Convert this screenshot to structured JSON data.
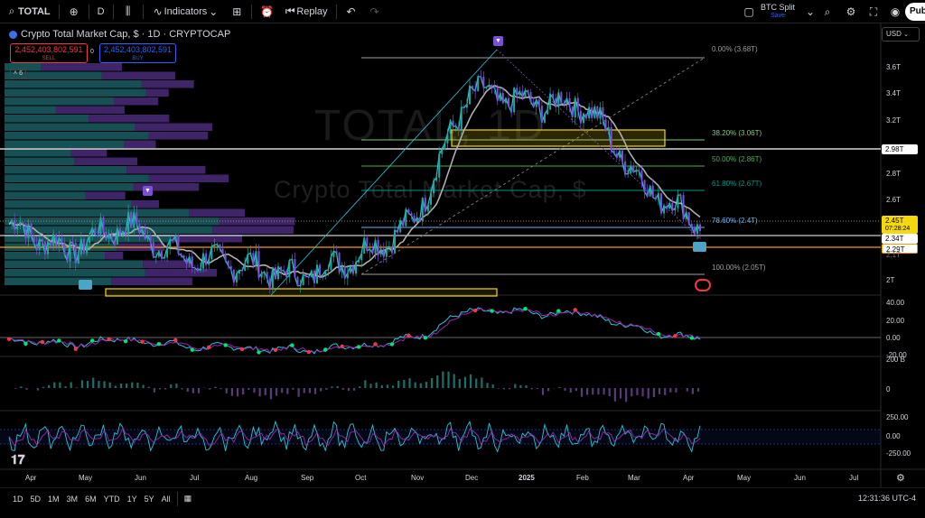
{
  "toolbar": {
    "symbol": "TOTAL",
    "interval": "D",
    "indicators_label": "Indicators",
    "replay_label": "Replay",
    "layout_name": "BTC Split",
    "layout_status": "Save",
    "publish_label": "Pub"
  },
  "legend": {
    "title": "Crypto Total Market Cap, $ · 1D · CRYPTOCAP",
    "sell_value": "2,452,403,802,591",
    "sell_label": "SELL",
    "spread": "0",
    "buy_value": "2,452,403,802,591",
    "buy_label": "BUY",
    "collapsed_count": "6"
  },
  "watermark": {
    "symbol": "TOTAL, 1D",
    "name": "Crypto Total Market Cap, $"
  },
  "currency": "USD",
  "price_axis": [
    "3.6T",
    "3.4T",
    "3.2T",
    "2.98T",
    "2.8T",
    "2.6T",
    "2.45T",
    "07:28:24",
    "2.34T",
    "2.29T",
    "2.1T",
    "2T"
  ],
  "fib_levels": [
    {
      "label": "0.00% (3.68T)",
      "color": "#9e9e9e"
    },
    {
      "label": "38.20% (3.06T)",
      "color": "#81c784"
    },
    {
      "label": "50.00% (2.86T)",
      "color": "#4caf50"
    },
    {
      "label": "61.80% (2.67T)",
      "color": "#009688"
    },
    {
      "label": "78.60% (2.4T)",
      "color": "#64b5f6"
    },
    {
      "label": "100.00% (2.05T)",
      "color": "#9e9e9e"
    }
  ],
  "indicator_axes": {
    "rsi_like": [
      "40.00",
      "20.00",
      "0.00",
      "-20.00"
    ],
    "volume_like": [
      "200 B",
      "0"
    ],
    "cci_like": [
      "250.00",
      "0.00",
      "-250.00"
    ]
  },
  "time_axis": [
    "Apr",
    "May",
    "Jun",
    "Jul",
    "Aug",
    "Sep",
    "Oct",
    "Nov",
    "Dec",
    "2025",
    "Feb",
    "Mar",
    "Apr",
    "May",
    "Jun",
    "Jul"
  ],
  "ranges": [
    "1D",
    "5D",
    "1M",
    "3M",
    "6M",
    "YTD",
    "1Y",
    "5Y",
    "All"
  ],
  "clock": "12:31:36 UTC-4",
  "colors": {
    "up": "#26a69a",
    "down": "#7b4fd8",
    "highlight": "#f5d90a",
    "current_price": "#f5d90a"
  },
  "chart_data": {
    "type": "line",
    "title": "Crypto Total Market Cap, $ · 1D · CRYPTOCAP",
    "x": [
      "Apr",
      "May",
      "Jun",
      "Jul",
      "Aug",
      "Sep",
      "Oct",
      "Nov",
      "Dec",
      "2025",
      "Feb",
      "Mar",
      "Apr"
    ],
    "series": [
      {
        "values": [
          2.45,
          2.25,
          2.45,
          2.2,
          2.15,
          2.05,
          2.2,
          2.45,
          3.45,
          3.35,
          3.35,
          2.75,
          2.45
        ]
      }
    ],
    "ylim": [
      1.95,
      3.75
    ]
  }
}
